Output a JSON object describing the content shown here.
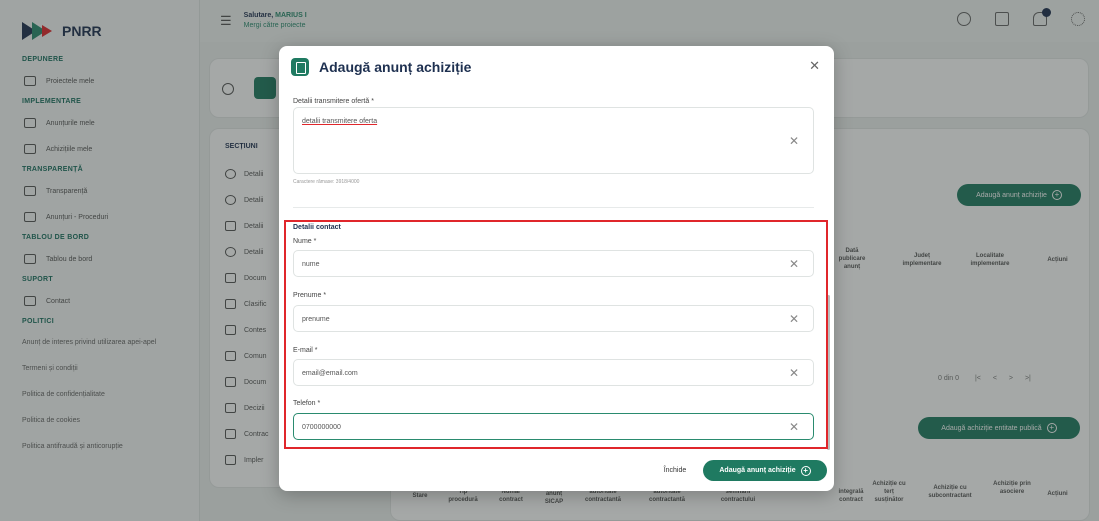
{
  "brand": {
    "name": "PNRR",
    "colors": {
      "primary": "#1f7a61",
      "navy": "#1e3050",
      "highlight": "#e0262b"
    }
  },
  "header": {
    "greeting": "Salutare, ",
    "user": "MARIUS I",
    "subtitle": "Mergi către proiecte"
  },
  "sidebar": {
    "sections": [
      {
        "title": "DEPUNERE",
        "items": [
          {
            "label": "Proiectele mele",
            "icon": "folder-icon"
          }
        ]
      },
      {
        "title": "IMPLEMENTARE",
        "items": [
          {
            "label": "Anunțurile mele",
            "icon": "folder-icon"
          },
          {
            "label": "Achizițiile mele",
            "icon": "document-icon"
          }
        ]
      },
      {
        "title": "TRANSPARENȚĂ",
        "items": [
          {
            "label": "Transparență",
            "icon": "table-icon"
          },
          {
            "label": "Anunțuri - Proceduri",
            "icon": "copy-icon"
          }
        ]
      },
      {
        "title": "TABLOU DE BORD",
        "items": [
          {
            "label": "Tablou de bord",
            "icon": "chart-icon"
          }
        ]
      },
      {
        "title": "SUPORT",
        "items": [
          {
            "label": "Contact",
            "icon": "mail-icon"
          }
        ]
      },
      {
        "title": "POLITICI",
        "items": []
      }
    ],
    "links": [
      "Anunț de interes privind utilizarea apei-apel",
      "Termeni și condiții",
      "Politica de confidențialitate",
      "Politica de cookies",
      "Politica antifraudă și anticorupție"
    ]
  },
  "background": {
    "sections_title": "SECȚIUNI",
    "sections": [
      "Detalii",
      "Detalii",
      "Detalii",
      "Detalii",
      "Docum",
      "Clasific",
      "Contes",
      "Comun",
      "Docum",
      "Decizii",
      "Contrac",
      "Impler"
    ],
    "add_announcement_btn": "Adaugă anunț achiziție",
    "table_headers": [
      "Dată publicare anunț",
      "Județ implementare",
      "Localitate implementare",
      "Acțiuni"
    ],
    "pager": "0 din 0",
    "add_entity_btn": "Adaugă achiziție entitate publică",
    "bottom_headers": [
      "Stare",
      "Tip procedură",
      "Număr contract",
      "anunț SICAP",
      "autoritate contractantă",
      "autoritate contractantă",
      "semnării contractului",
      "integrală contract",
      "Achiziție cu terț susținător",
      "Achiziție cu subcontractant",
      "Achiziție prin asociere",
      "Acțiuni"
    ]
  },
  "modal": {
    "title": "Adaugă anunț achiziție",
    "offer": {
      "label": "Detalii transmitere ofertă *",
      "value": "detalii transmitere oferta",
      "hint": "Caractere rămase: 3918/4000"
    },
    "contact": {
      "title": "Detalii contact",
      "fields": [
        {
          "label": "Nume *",
          "value": "nume"
        },
        {
          "label": "Prenume *",
          "value": "prenume"
        },
        {
          "label": "E-mail *",
          "value": "email@email.com"
        },
        {
          "label": "Telefon *",
          "value": "0700000000"
        }
      ]
    },
    "close_btn": "Închide",
    "submit_btn": "Adaugă anunț achiziție"
  }
}
